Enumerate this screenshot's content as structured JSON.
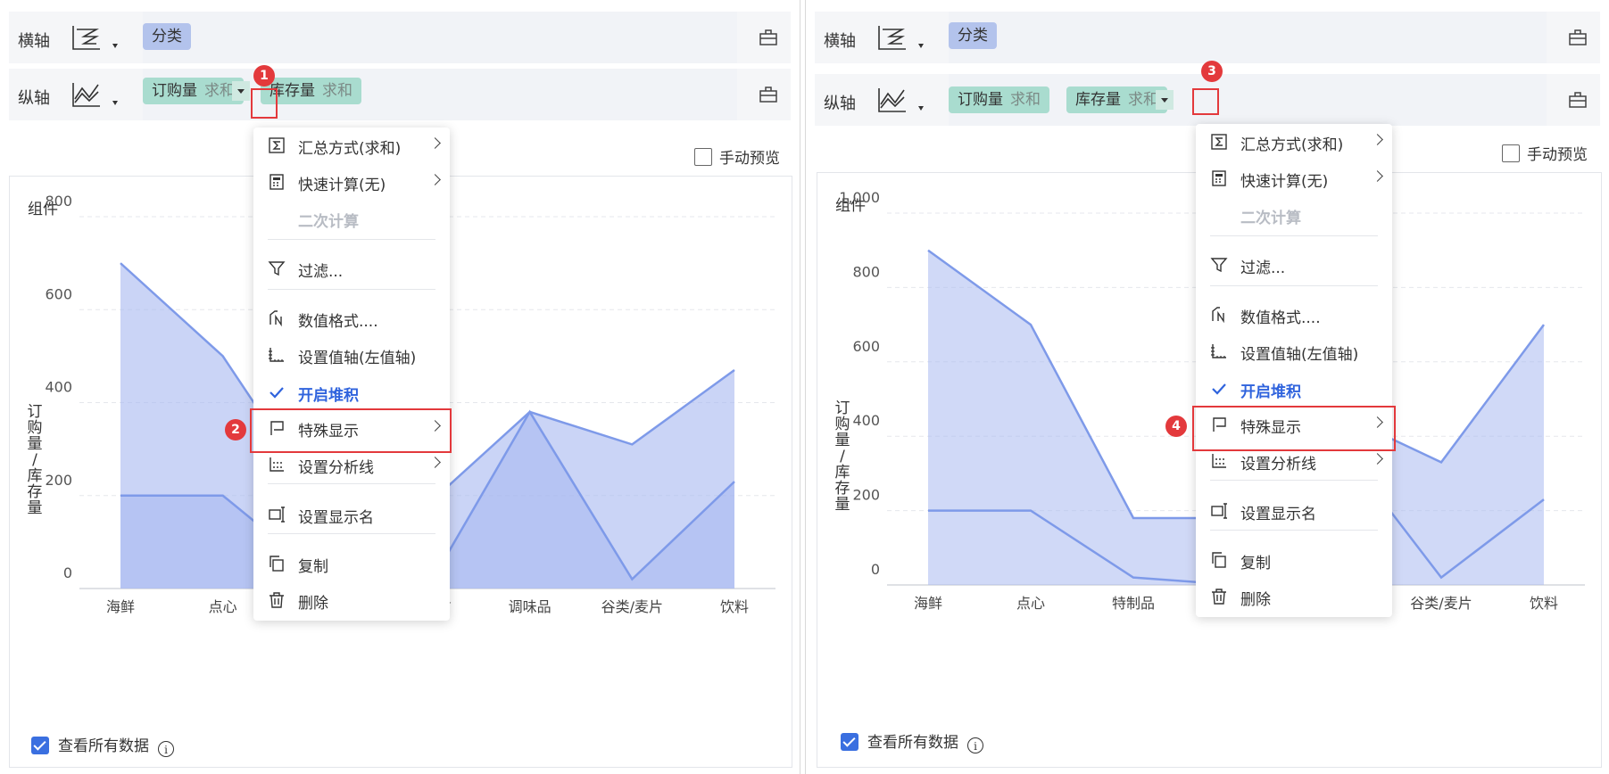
{
  "axes": {
    "x_label": "横轴",
    "y_label": "纵轴",
    "dimension_pill": "分类",
    "measure_pills": [
      {
        "name": "订购量",
        "agg": "求和"
      },
      {
        "name": "库存量",
        "agg": "求和"
      }
    ]
  },
  "manual_preview": "手动预览",
  "card_title": "组件",
  "y_axis_title": "订购量/库存量",
  "view_all": "查看所有数据",
  "info_glyph": "i",
  "menu": {
    "items": [
      {
        "label": "汇总方式(求和)",
        "icon": "sigma-icon",
        "submenu": true
      },
      {
        "label": "快速计算(无)",
        "icon": "calculator-icon",
        "submenu": true
      },
      {
        "label": "二次计算",
        "disabled": true
      },
      {
        "label": "过滤...",
        "icon": "filter-icon"
      },
      {
        "label": "数值格式....",
        "icon": "number-format-icon"
      },
      {
        "label": "设置值轴(左值轴)",
        "icon": "value-axis-icon"
      },
      {
        "label": "开启堆积",
        "icon": "check-icon",
        "active": true
      },
      {
        "label": "特殊显示",
        "icon": "flag-icon",
        "submenu": true
      },
      {
        "label": "设置分析线",
        "icon": "analysis-line-icon",
        "submenu": true
      },
      {
        "label": "设置显示名",
        "icon": "rename-icon"
      },
      {
        "label": "复制",
        "icon": "copy-icon"
      },
      {
        "label": "删除",
        "icon": "trash-icon"
      }
    ]
  },
  "badges": [
    "1",
    "2",
    "3",
    "4"
  ],
  "colors": {
    "accent": "#2f63dd",
    "highlight": "#e3393c",
    "area_fill": "#a9baf0",
    "area_line": "#7e9ae9",
    "measure_pill": "#a9dccf",
    "dimension_pill": "#b3c3ec"
  },
  "chart_data": [
    {
      "type": "area",
      "stacked": false,
      "categories": [
        "海鲜",
        "点心",
        "特制品",
        "肉/家禽",
        "调味品",
        "谷类/麦片",
        "饮料"
      ],
      "series": [
        {
          "name": "订购量",
          "values": [
            700,
            500,
            170,
            180,
            380,
            310,
            470
          ]
        },
        {
          "name": "库存量",
          "values": [
            200,
            200,
            20,
            0,
            380,
            20,
            230
          ]
        }
      ],
      "yticks": [
        "0",
        "200",
        "400",
        "600",
        "800"
      ],
      "ylim": [
        0,
        800
      ]
    },
    {
      "type": "area",
      "stacked": true,
      "categories": [
        "海鲜",
        "点心",
        "特制品",
        "肉/家禽",
        "调味品",
        "谷类/麦片",
        "饮料"
      ],
      "series": [
        {
          "name": "库存量",
          "values": [
            200,
            200,
            20,
            0,
            380,
            20,
            230
          ]
        },
        {
          "name": "订购量",
          "values": [
            700,
            500,
            160,
            180,
            80,
            310,
            470
          ]
        }
      ],
      "yticks": [
        "0",
        "200",
        "400",
        "600",
        "800",
        "1,000"
      ],
      "ylim": [
        0,
        1000
      ]
    }
  ]
}
